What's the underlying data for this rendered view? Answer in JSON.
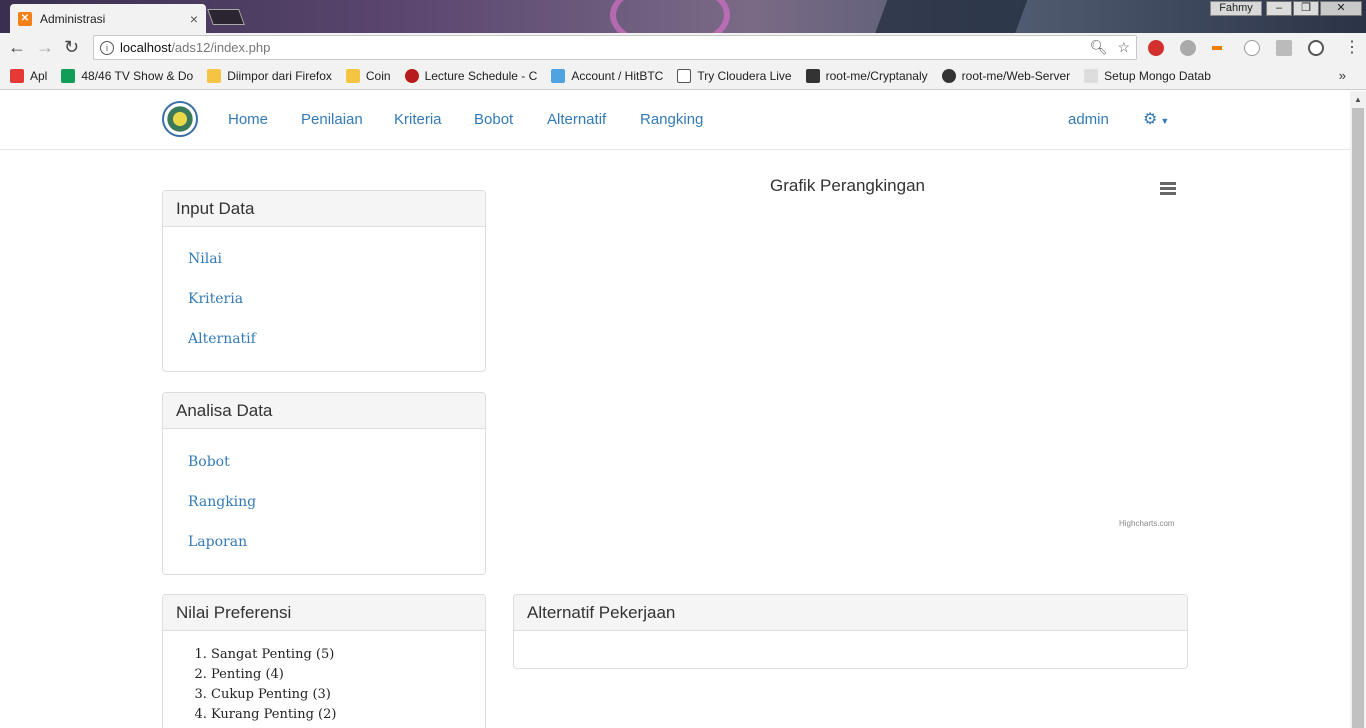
{
  "browser": {
    "tab_title": "Administrasi",
    "tab_close": "×",
    "window_user": "Fahmy",
    "url_host": "localhost",
    "url_path": "/ads12/index.php",
    "bookmarks": [
      {
        "label": "Apl",
        "color": "#e53935"
      },
      {
        "label": "48/46 TV Show & Do",
        "color": "#0f9d58"
      },
      {
        "label": "Diimpor dari Firefox",
        "color": "#f4c542"
      },
      {
        "label": "Coin",
        "color": "#f4c542"
      },
      {
        "label": "Lecture Schedule - C",
        "color": "#b71c1c"
      },
      {
        "label": "Account / HitBTC",
        "color": "#4fa3e0"
      },
      {
        "label": "Try Cloudera Live",
        "color": "#ffffff"
      },
      {
        "label": "root-me/Cryptanaly",
        "color": "#333333"
      },
      {
        "label": "root-me/Web-Server",
        "color": "#333333"
      },
      {
        "label": "Setup Mongo Datab",
        "color": "#dddddd"
      }
    ],
    "bookmarks_more": "»"
  },
  "navbar": {
    "links": [
      "Home",
      "Penilaian",
      "Kriteria",
      "Bobot",
      "Alternatif",
      "Rangking"
    ],
    "user": "admin"
  },
  "input_panel": {
    "title": "Input Data",
    "links": [
      "Nilai",
      "Kriteria",
      "Alternatif"
    ]
  },
  "analisa_panel": {
    "title": "Analisa Data",
    "links": [
      "Bobot",
      "Rangking",
      "Laporan"
    ]
  },
  "preferensi_panel": {
    "title": "Nilai Preferensi",
    "items": [
      "Sangat Penting (5)",
      "Penting (4)",
      "Cukup Penting (3)",
      "Kurang Penting (2)"
    ]
  },
  "chart": {
    "title": "Grafik Perangkingan",
    "credits": "Highcharts.com"
  },
  "alternatif_panel": {
    "title": "Alternatif Pekerjaan"
  }
}
